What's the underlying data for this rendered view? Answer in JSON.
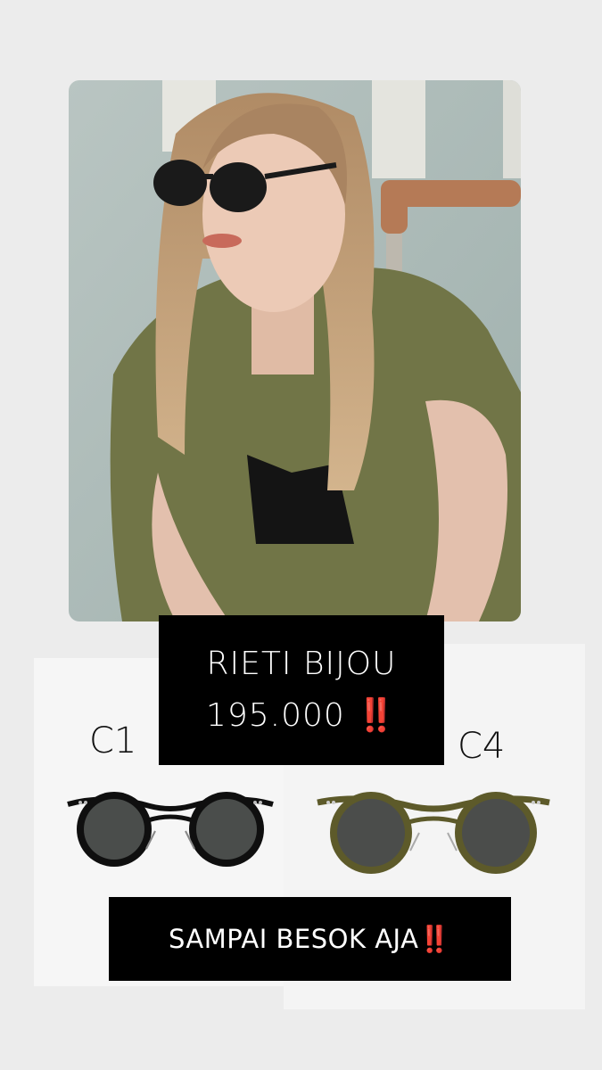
{
  "product": {
    "name": "RIETI BIJOU",
    "price": "195.000",
    "price_alert": "‼️"
  },
  "variants": [
    {
      "label": "C1",
      "frame_color": "#0f0f0f"
    },
    {
      "label": "C4",
      "frame_color": "#5d5a2a"
    }
  ],
  "cta": {
    "text": "SAMPAI BESOK AJA",
    "alert": "‼️"
  },
  "colors": {
    "background": "#ececec",
    "box": "#000000",
    "alert": "#e3251c"
  }
}
